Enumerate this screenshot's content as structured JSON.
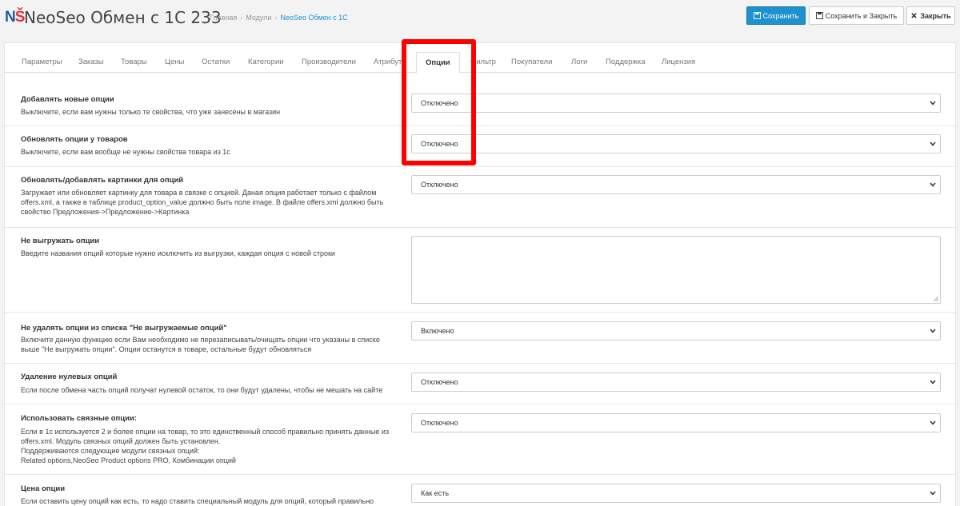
{
  "header": {
    "logo_n": "N",
    "logo_s": "Š",
    "title": "NeoSeo Обмен с 1С 233",
    "breadcrumb": [
      {
        "label": "Главная"
      },
      {
        "label": "Модули"
      },
      {
        "label": "NeoSeo Обмен с 1С"
      }
    ],
    "buttons": {
      "save": "Сохранить",
      "save_close": "Сохранить и Закрыть",
      "close": "Закрыть"
    }
  },
  "tabs": [
    {
      "label": "Параметры"
    },
    {
      "label": "Заказы"
    },
    {
      "label": "Товары"
    },
    {
      "label": "Цены"
    },
    {
      "label": "Остатки"
    },
    {
      "label": "Категории"
    },
    {
      "label": "Производители"
    },
    {
      "label": "Атрибут"
    },
    {
      "label": "Опции"
    },
    {
      "label": "Фильтр"
    },
    {
      "label": "Покупатели"
    },
    {
      "label": "Логи"
    },
    {
      "label": "Поддержка"
    },
    {
      "label": "Лицензия"
    }
  ],
  "active_tab": "Опции",
  "rows": [
    {
      "title": "Добавлять новые опции",
      "help": "Выключите, если вам нужны только те свойства, что уже занесены в магазин",
      "value": "Отключено"
    },
    {
      "title": "Обновлять опции у товаров",
      "help": "Выключите, если вам вообще не нужны свойства товара из 1с",
      "value": "Отключено"
    },
    {
      "title": "Обновлять/добавлять картинки для опций",
      "help": "Загружает или обновляет картинку для товара в связке с опцией. Даная опция работает только с файлом offers.xml, а также в таблице product_option_value должно быть поле image. В файле offers.xml должно быть свойство Предложения->Предложение->Картинка",
      "value": "Отключено"
    },
    {
      "title": "Не выгружать опции",
      "help": "Введите названия опций которые нужно исключить из выгрузки, каждая опция с новой строки",
      "value": ""
    },
    {
      "title": "Не удалять опции из списка \"Не выгружаемые опций\"",
      "help": "Включите данную функцию если Вам необходимо не перезаписывать/очищать опции что указаны в списке выше \"Не выгружать опции\". Опции останутся в товаре, остальные будут обновляться",
      "value": "Включено"
    },
    {
      "title": "Удаление нулевых опций",
      "help": "Если после обмена часть опций получат нулевой остаток, то они будут удалены, чтобы не мешать на сайте",
      "value": "Отключено"
    },
    {
      "title": "Использовать связные опции:",
      "help": "Если в 1с используется 2 и более опции на товар, то это единственный способ правильно принять данные из offers.xml. Модуль связных опций должен быть установлен.\nПоддерживаются следующие модули связных опций:\nRelated options,NeoSeo Product options PRO, Комбинации опций",
      "value": "Отключено"
    },
    {
      "title": "Цена опции",
      "help": "Если оставить цену опций как есть, то надо ставить специальный модуль для опций, который правильно",
      "value": "Как есть"
    }
  ],
  "colors": {
    "primary": "#1e91cf",
    "highlight": "#ff0000",
    "logo_blue": "#1f5a9e",
    "logo_red": "#e43131"
  }
}
